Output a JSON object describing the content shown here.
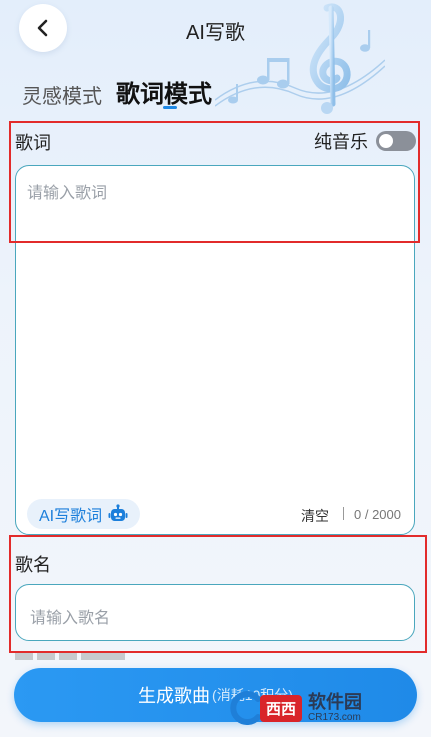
{
  "header": {
    "title": "AI写歌"
  },
  "tabs": [
    {
      "label": "灵感模式",
      "active": false
    },
    {
      "label": "歌词模式",
      "active": true
    }
  ],
  "lyrics": {
    "label": "歌词",
    "pure_music_label": "纯音乐",
    "pure_music_on": false,
    "placeholder": "请输入歌词",
    "ai_button_label": "AI写歌词",
    "clear_label": "清空",
    "counter": "0 / 2000"
  },
  "song_name": {
    "label": "歌名",
    "placeholder": "请输入歌名"
  },
  "generate": {
    "label": "生成歌曲",
    "sub_label": "(消耗10积分)"
  },
  "watermark": {
    "badge": "西西",
    "name": "软件园",
    "url": "CR173.com"
  },
  "colors": {
    "accent": "#1e88e5",
    "input_border": "#4aa7bd",
    "highlight_frame": "#e22b2b"
  }
}
